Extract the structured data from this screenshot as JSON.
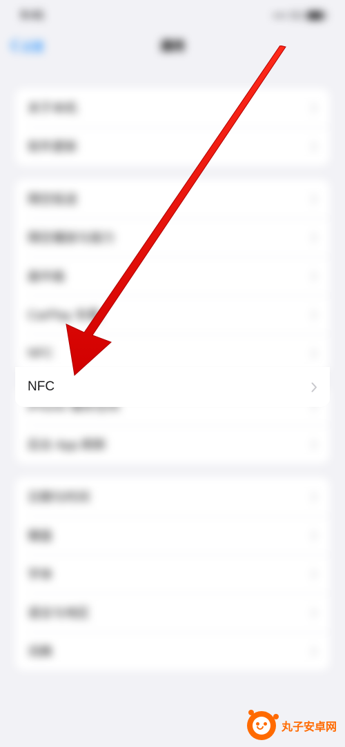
{
  "status": {
    "time": "9:41"
  },
  "nav": {
    "back": "设置",
    "title": "通用"
  },
  "groups": [
    {
      "rows": [
        {
          "label": "关于本机"
        },
        {
          "label": "软件更新"
        }
      ]
    },
    {
      "rows": [
        {
          "label": "隔空投送"
        },
        {
          "label": "隔空播放与接力"
        },
        {
          "label": "画中画"
        },
        {
          "label": "CarPlay 车载"
        },
        {
          "label": "NFC"
        }
      ]
    },
    {
      "rows": [
        {
          "label": "iPhone 储存空间"
        },
        {
          "label": "后台 App 刷新"
        }
      ]
    },
    {
      "rows": [
        {
          "label": "日期与时间"
        },
        {
          "label": "键盘"
        },
        {
          "label": "字体"
        },
        {
          "label": "语言与地区"
        },
        {
          "label": "词典"
        }
      ]
    }
  ],
  "focus": {
    "label": "NFC"
  },
  "watermark": {
    "text": "丸子安卓网"
  }
}
